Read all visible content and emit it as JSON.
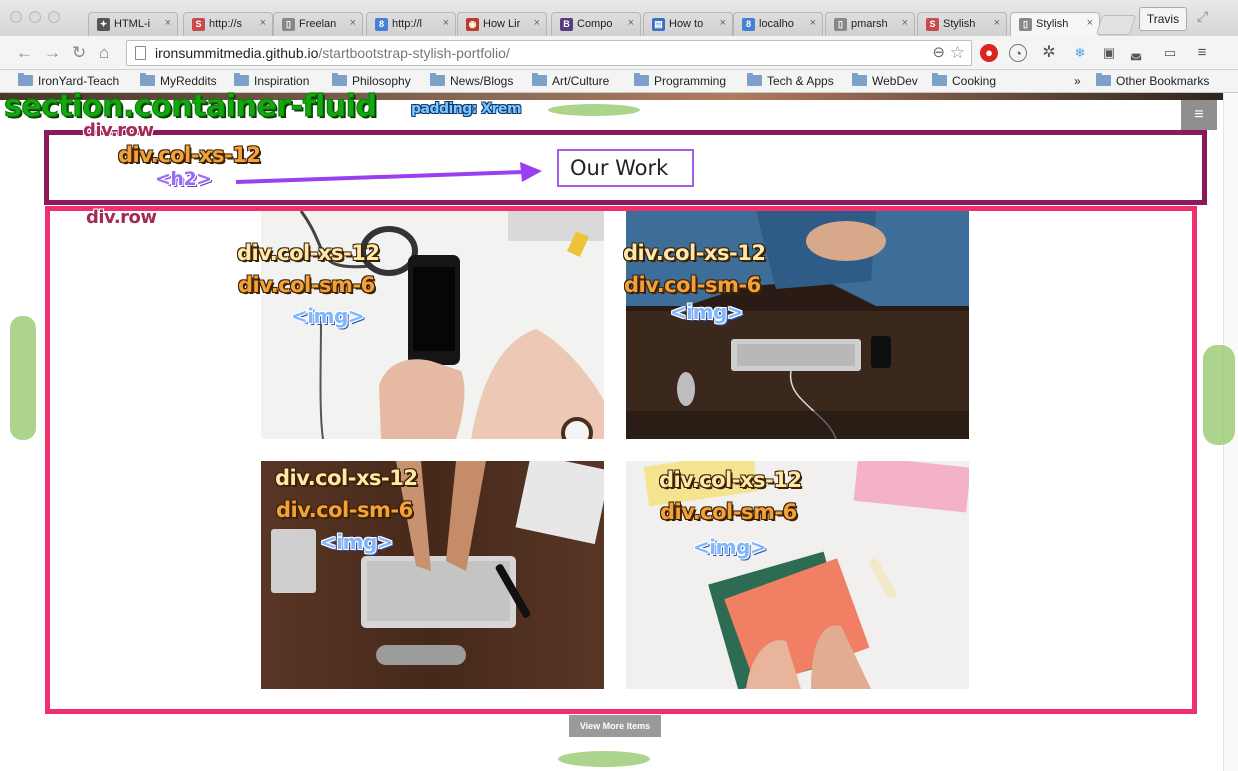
{
  "browser": {
    "tabs": [
      {
        "label": "HTML-i",
        "fav": "✦",
        "fav_color": "#555555"
      },
      {
        "label": "http://s",
        "fav": "S",
        "fav_color": "#c94a4a"
      },
      {
        "label": "Freelan",
        "fav": "▯",
        "fav_color": "#888888"
      },
      {
        "label": "http://l",
        "fav": "8",
        "fav_color": "#4a7fd8"
      },
      {
        "label": "How Lir",
        "fav": "◉",
        "fav_color": "#c0392b"
      },
      {
        "label": "Compo",
        "fav": "B",
        "fav_color": "#563d7c"
      },
      {
        "label": "How to",
        "fav": "▤",
        "fav_color": "#3a6fc4"
      },
      {
        "label": "localho",
        "fav": "8",
        "fav_color": "#4a7fd8"
      },
      {
        "label": "pmarsh",
        "fav": "▯",
        "fav_color": "#888888"
      },
      {
        "label": "Stylish",
        "fav": "S",
        "fav_color": "#c94a4a"
      },
      {
        "label": "Stylish",
        "fav": "▯",
        "fav_color": "#888888"
      }
    ],
    "profile_name": "Travis",
    "url_domain": "ironsummitmedia.github.io",
    "url_path": "/startbootstrap-stylish-portfolio/",
    "bookmarks": [
      "IronYard-Teach",
      "MyReddits",
      "Inspiration",
      "Philosophy",
      "News/Blogs",
      "Art/Culture",
      "Programming",
      "Tech & Apps",
      "WebDev",
      "Cooking"
    ],
    "bookmarks_overflow": "»",
    "other_bookmarks": "Other Bookmarks"
  },
  "page": {
    "menu_icon": "≡",
    "heading": "Our Work",
    "view_more": "View More Items"
  },
  "annotations": {
    "section": "section.container-fluid",
    "padding": "padding: Xrem",
    "row1": "div.row",
    "col_xs12": "div.col-xs-12",
    "h2": "<h2>",
    "row2": "div.row",
    "cells": [
      {
        "col1": "div.col-xs-12",
        "col2": "div.col-sm-6",
        "img": "<img>"
      },
      {
        "col1": "div.col-xs-12",
        "col2": "div.col-sm-6",
        "img": "<img>"
      },
      {
        "col1": "div.col-xs-12",
        "col2": "div.col-sm-6",
        "img": "<img>"
      },
      {
        "col1": "div.col-xs-12",
        "col2": "div.col-sm-6",
        "img": "<img>"
      }
    ]
  },
  "colors": {
    "row1_border": "#8c1a5a",
    "row2_border": "#f0306a",
    "h2_border": "#a55df0",
    "section_label": "#12a80e"
  }
}
